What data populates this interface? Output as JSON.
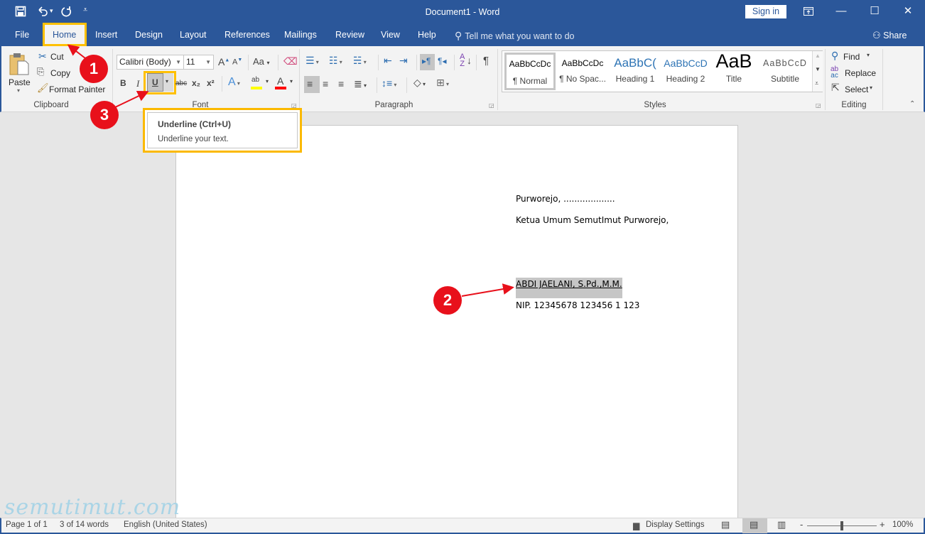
{
  "window": {
    "title": "Document1  -  Word",
    "sign_in": "Sign in",
    "qat": {
      "save": "save-icon",
      "undo": "undo-icon",
      "redo": "redo-icon",
      "customize": "customize-qat-icon"
    },
    "controls": {
      "ribbon_display": "ribbon-display-options-icon",
      "minimize": "—",
      "maximize": "☐",
      "close": "✕"
    }
  },
  "tabs": [
    {
      "label": "File"
    },
    {
      "label": "Home",
      "active": true
    },
    {
      "label": "Insert"
    },
    {
      "label": "Design"
    },
    {
      "label": "Layout"
    },
    {
      "label": "References"
    },
    {
      "label": "Mailings"
    },
    {
      "label": "Review"
    },
    {
      "label": "View"
    },
    {
      "label": "Help"
    }
  ],
  "tell_me": {
    "placeholder": "Tell me what you want to do"
  },
  "share": "Share",
  "ribbon": {
    "clipboard": {
      "label": "Clipboard",
      "paste": "Paste",
      "cut": "Cut",
      "copy": "Copy",
      "format_painter": "Format Painter"
    },
    "font": {
      "label": "Font",
      "font_name": "Calibri (Body)",
      "font_size": "11",
      "grow": "A",
      "shrink": "A",
      "change_case": "Aa",
      "bold": "B",
      "italic": "I",
      "underline": "U",
      "strikethrough": "abc",
      "subscript": "x₂",
      "superscript": "x²",
      "text_effects": "A",
      "highlight": "ab",
      "font_color": "A",
      "highlight_color": "#ffff00",
      "font_color_value": "#ff0000"
    },
    "paragraph": {
      "label": "Paragraph",
      "show_marks": "¶"
    },
    "styles": {
      "label": "Styles",
      "items": [
        {
          "preview": "AaBbCcDc",
          "name": "¶ Normal",
          "selected": true
        },
        {
          "preview": "AaBbCcDc",
          "name": "¶ No Spac..."
        },
        {
          "preview": "AaBbC(",
          "name": "Heading 1"
        },
        {
          "preview": "AaBbCcD",
          "name": "Heading 2"
        },
        {
          "preview": "AaB",
          "name": "Title"
        },
        {
          "preview": "AaBbCcD",
          "name": "Subtitle"
        }
      ]
    },
    "editing": {
      "label": "Editing",
      "find": "Find",
      "replace": "Replace",
      "select": "Select"
    }
  },
  "tooltip": {
    "title": "Underline (Ctrl+U)",
    "description": "Underline your text."
  },
  "document": {
    "lines": [
      "Purworejo, ...................",
      "Ketua Umum SemutImut Purworejo,",
      "ABDI JAELANI, S.Pd.,M.M.",
      "NIP. 12345678 123456 1 123"
    ]
  },
  "annotations": {
    "step1": "1",
    "step2": "2",
    "step3": "3",
    "highlight_color": "#ffc000",
    "badge_color": "#e8101b"
  },
  "watermark": "semutimut.com",
  "status": {
    "page": "Page 1 of 1",
    "words": "3 of 14 words",
    "language": "English (United States)",
    "display_settings": "Display Settings",
    "zoom_minus": "-",
    "zoom_plus": "+",
    "zoom": "100%",
    "zoom_fraction": 0.5
  }
}
